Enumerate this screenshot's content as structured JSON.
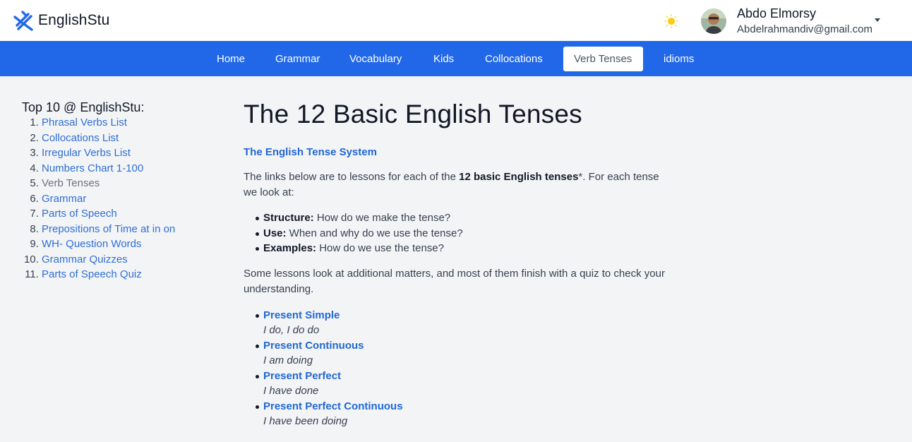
{
  "header": {
    "brand": "EnglishStu",
    "user": {
      "name": "Abdo Elmorsy",
      "email": "Abdelrahmandiv@gmail.com"
    },
    "icons": [
      "logo-icon",
      "sun-icon",
      "avatar",
      "caret-down-icon"
    ]
  },
  "nav": {
    "items": [
      "Home",
      "Grammar",
      "Vocabulary",
      "Kids",
      "Collocations",
      "Verb Tenses",
      "idioms"
    ],
    "active": "Verb Tenses"
  },
  "sidebar": {
    "title": "Top 10 @ EnglishStu:",
    "items": [
      "Phrasal Verbs List",
      "Collocations List",
      "Irregular Verbs List",
      "Numbers Chart 1-100",
      "Verb Tenses",
      "Grammar",
      "Parts of Speech",
      "Prepositions of Time at in on",
      "WH- Question Words",
      "Grammar Quizzes",
      "Parts of Speech Quiz"
    ]
  },
  "main": {
    "title": "The 12 Basic English Tenses",
    "section_link": "The English Tense System",
    "intro": {
      "before": "The links below are to lessons for each of the ",
      "bold": "12 basic English tenses",
      "after": "*. For each tense we look at:"
    },
    "aspects": [
      {
        "label": "Structure:",
        "text": " How do we make the tense?"
      },
      {
        "label": "Use:",
        "text": " When and why do we use the tense?"
      },
      {
        "label": "Examples:",
        "text": " How do we use the tense?"
      }
    ],
    "note": "Some lessons look at additional matters, and most of them finish with a quiz to check your understanding.",
    "tenses": [
      {
        "name": "Present Simple",
        "example": "I do, I do do"
      },
      {
        "name": "Present Continuous",
        "example": "I am doing"
      },
      {
        "name": "Present Perfect",
        "example": "I have done"
      },
      {
        "name": "Present Perfect Continuous",
        "example": "I have been doing"
      }
    ]
  },
  "colors": {
    "nav_bg": "#2168e8",
    "link": "#2168d6",
    "page_bg": "#f3f4f6"
  }
}
